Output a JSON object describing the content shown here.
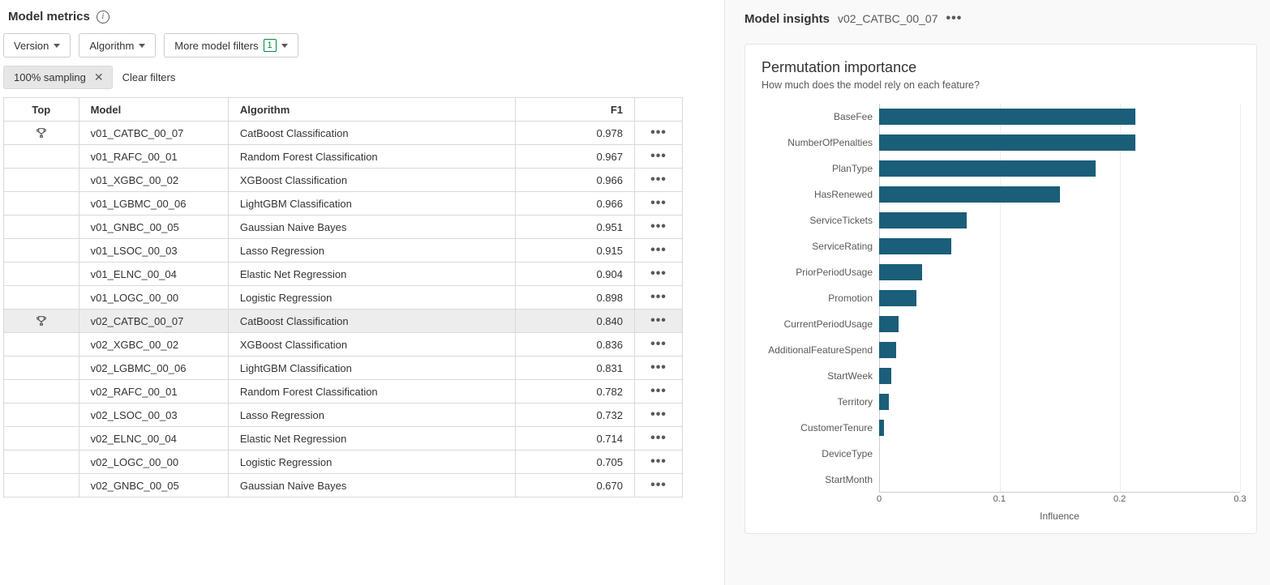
{
  "left": {
    "title": "Model metrics",
    "filters": {
      "version_label": "Version",
      "algorithm_label": "Algorithm",
      "more_label": "More model filters",
      "more_count": "1"
    },
    "chips": {
      "sampling": "100% sampling",
      "clear": "Clear filters"
    },
    "table": {
      "headers": {
        "top": "Top",
        "model": "Model",
        "algorithm": "Algorithm",
        "f1": "F1"
      },
      "rows": [
        {
          "top": true,
          "model": "v01_CATBC_00_07",
          "algorithm": "CatBoost Classification",
          "f1": "0.978",
          "selected": false
        },
        {
          "top": false,
          "model": "v01_RAFC_00_01",
          "algorithm": "Random Forest Classification",
          "f1": "0.967",
          "selected": false
        },
        {
          "top": false,
          "model": "v01_XGBC_00_02",
          "algorithm": "XGBoost Classification",
          "f1": "0.966",
          "selected": false
        },
        {
          "top": false,
          "model": "v01_LGBMC_00_06",
          "algorithm": "LightGBM Classification",
          "f1": "0.966",
          "selected": false
        },
        {
          "top": false,
          "model": "v01_GNBC_00_05",
          "algorithm": "Gaussian Naive Bayes",
          "f1": "0.951",
          "selected": false
        },
        {
          "top": false,
          "model": "v01_LSOC_00_03",
          "algorithm": "Lasso Regression",
          "f1": "0.915",
          "selected": false
        },
        {
          "top": false,
          "model": "v01_ELNC_00_04",
          "algorithm": "Elastic Net Regression",
          "f1": "0.904",
          "selected": false
        },
        {
          "top": false,
          "model": "v01_LOGC_00_00",
          "algorithm": "Logistic Regression",
          "f1": "0.898",
          "selected": false
        },
        {
          "top": true,
          "model": "v02_CATBC_00_07",
          "algorithm": "CatBoost Classification",
          "f1": "0.840",
          "selected": true
        },
        {
          "top": false,
          "model": "v02_XGBC_00_02",
          "algorithm": "XGBoost Classification",
          "f1": "0.836",
          "selected": false
        },
        {
          "top": false,
          "model": "v02_LGBMC_00_06",
          "algorithm": "LightGBM Classification",
          "f1": "0.831",
          "selected": false
        },
        {
          "top": false,
          "model": "v02_RAFC_00_01",
          "algorithm": "Random Forest Classification",
          "f1": "0.782",
          "selected": false
        },
        {
          "top": false,
          "model": "v02_LSOC_00_03",
          "algorithm": "Lasso Regression",
          "f1": "0.732",
          "selected": false
        },
        {
          "top": false,
          "model": "v02_ELNC_00_04",
          "algorithm": "Elastic Net Regression",
          "f1": "0.714",
          "selected": false
        },
        {
          "top": false,
          "model": "v02_LOGC_00_00",
          "algorithm": "Logistic Regression",
          "f1": "0.705",
          "selected": false
        },
        {
          "top": false,
          "model": "v02_GNBC_00_05",
          "algorithm": "Gaussian Naive Bayes",
          "f1": "0.670",
          "selected": false
        }
      ]
    }
  },
  "right": {
    "title": "Model insights",
    "model_name": "v02_CATBC_00_07",
    "chart": {
      "title": "Permutation importance",
      "subtitle": "How much does the model rely on each feature?",
      "xlabel": "Influence"
    }
  },
  "chart_data": {
    "type": "bar",
    "orientation": "horizontal",
    "title": "Permutation importance",
    "subtitle": "How much does the model rely on each feature?",
    "xlabel": "Influence",
    "ylabel": "",
    "xlim": [
      0,
      0.3
    ],
    "xticks": [
      0,
      0.1,
      0.2,
      0.3
    ],
    "categories": [
      "BaseFee",
      "NumberOfPenalties",
      "PlanType",
      "HasRenewed",
      "ServiceTickets",
      "ServiceRating",
      "PriorPeriodUsage",
      "Promotion",
      "CurrentPeriodUsage",
      "AdditionalFeatureSpend",
      "StartWeek",
      "Territory",
      "CustomerTenure",
      "DeviceType",
      "StartMonth"
    ],
    "values": [
      0.213,
      0.213,
      0.18,
      0.15,
      0.073,
      0.06,
      0.036,
      0.031,
      0.016,
      0.014,
      0.01,
      0.008,
      0.004,
      0.0,
      0.0
    ],
    "bar_color": "#1a5e7a"
  }
}
